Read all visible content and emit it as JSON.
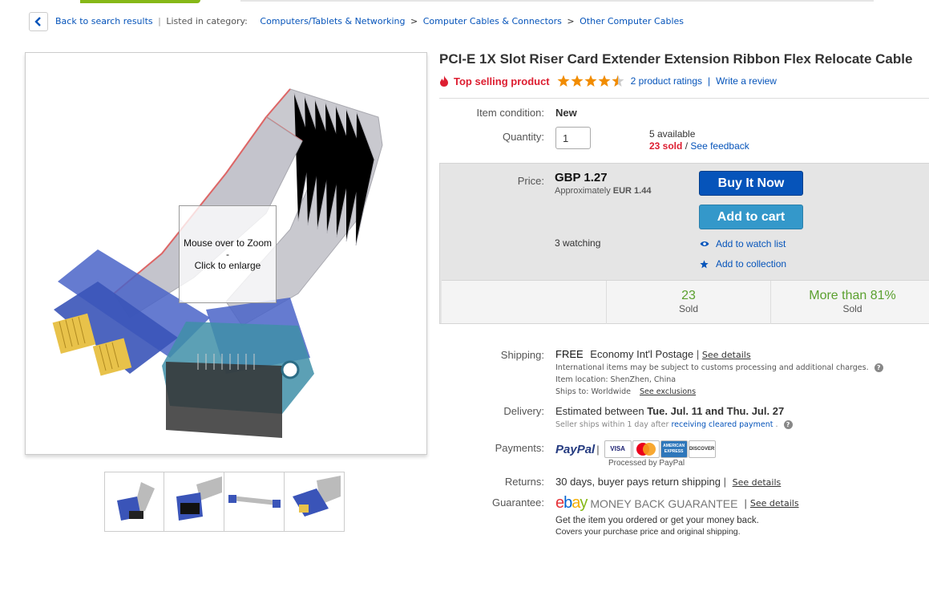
{
  "breadcrumb": {
    "back_label": "Back to search results",
    "listed_in": "Listed in category:",
    "categories": [
      "Computers/Tablets & Networking",
      "Computer Cables & Connectors",
      "Other Computer Cables"
    ]
  },
  "gallery": {
    "zoom_line1": "Mouse over to Zoom",
    "zoom_dash": "-",
    "zoom_line2": "Click to enlarge",
    "thumbnail_count": 4
  },
  "item": {
    "title": "PCI-E 1X Slot Riser Card Extender Extension Ribbon Flex Relocate Cable",
    "top_selling": "Top selling product",
    "rating_stars": 4.5,
    "ratings_link": "2 product ratings",
    "review_link": "Write a review"
  },
  "details": {
    "condition_label": "Item condition:",
    "condition_value": "New",
    "quantity_label": "Quantity:",
    "quantity_value": "1",
    "available": "5 available",
    "sold": "23 sold",
    "slash": "/",
    "feedback_link": "See feedback"
  },
  "buy": {
    "price_label": "Price:",
    "price": "GBP 1.27",
    "approx_prefix": "Approximately",
    "approx_value": "EUR 1.44",
    "buy_now": "Buy It Now",
    "add_to_cart": "Add to cart",
    "watching": "3 watching",
    "watch_link": "Add to watch list",
    "collection_link": "Add to collection",
    "stat1_big": "23",
    "stat1_small": "Sold",
    "stat2_big": "More than 81%",
    "stat2_small": "Sold"
  },
  "shipping": {
    "label": "Shipping:",
    "free": "FREE",
    "service": "Economy Int'l Postage",
    "see_details": "See details",
    "customs_note": "International items may be subject to customs processing and additional charges.",
    "location": "Item location:  ShenZhen, China",
    "ships_to": "Ships to:  Worldwide",
    "exclusions": "See exclusions"
  },
  "delivery": {
    "label": "Delivery:",
    "prefix": "Estimated between",
    "dates": "Tue. Jul. 11 and Thu. Jul. 27",
    "handling_prefix": "Seller ships within 1 day after",
    "handling_link": "receiving cleared payment",
    "dot": "."
  },
  "payments": {
    "label": "Payments:",
    "paypal": "PayPal",
    "processed": "Processed by PayPal",
    "cards": [
      "VISA",
      "MasterCard",
      "AMERICAN EXPRESS",
      "DISCOVER"
    ]
  },
  "returns": {
    "label": "Returns:",
    "text": "30 days, buyer pays return shipping",
    "see_details": "See details"
  },
  "guarantee": {
    "label": "Guarantee:",
    "logo": "ebay",
    "money_back": "MONEY BACK GUARANTEE",
    "see_details": "See details",
    "line1": "Get the item you ordered or get your money back.",
    "line2": "Covers your purchase price and original shipping."
  },
  "colors": {
    "link": "#0654ba",
    "buy_now": "#0654ba",
    "add_to_cart": "#3498ca",
    "top_selling": "#dd1e31",
    "stat_green": "#5ba02f",
    "star": "#f18c00"
  }
}
